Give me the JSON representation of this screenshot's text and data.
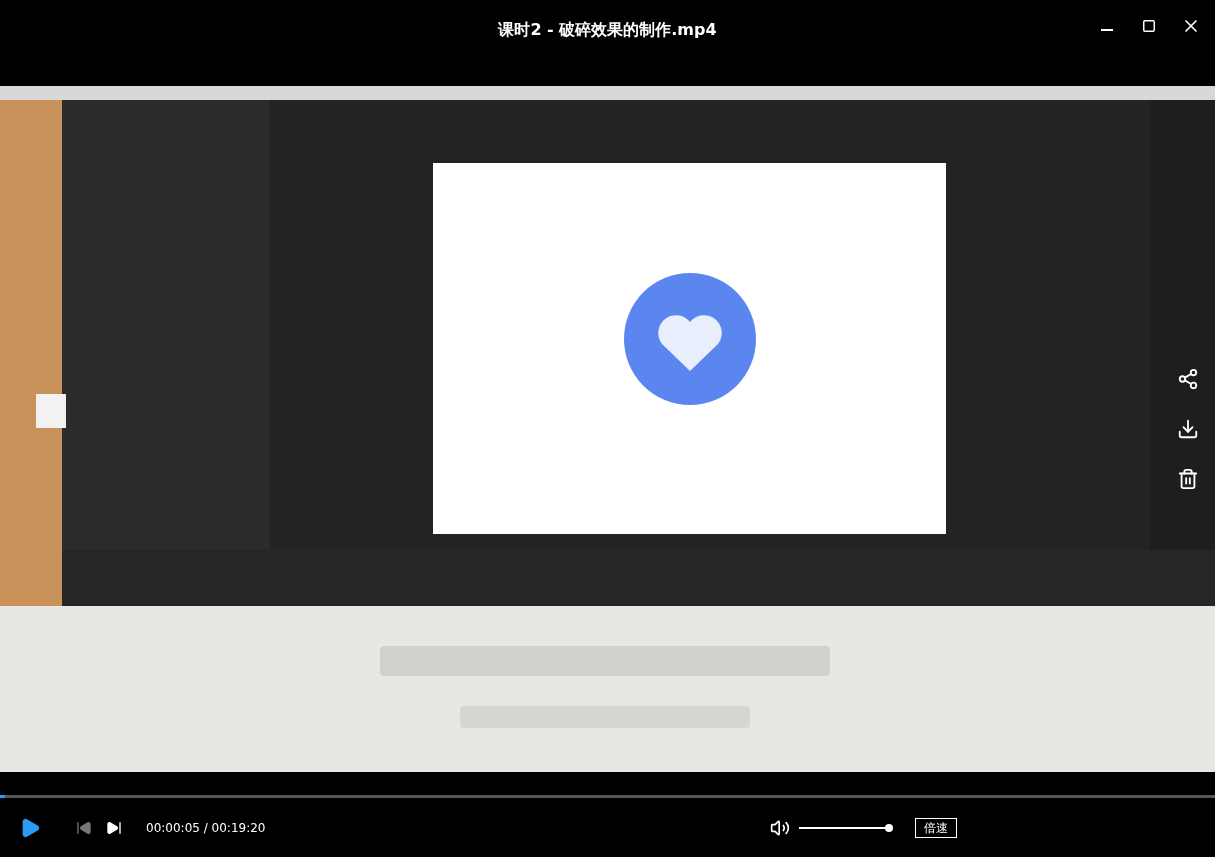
{
  "window": {
    "title": "课时2 - 破碎效果的制作.mp4"
  },
  "progress": {
    "level": 0.004
  },
  "controls": {
    "playing": false,
    "time": "00:00:05 / 00:19:20",
    "volume": {
      "muted": false,
      "level": 1
    },
    "speed_button": "倍速"
  }
}
